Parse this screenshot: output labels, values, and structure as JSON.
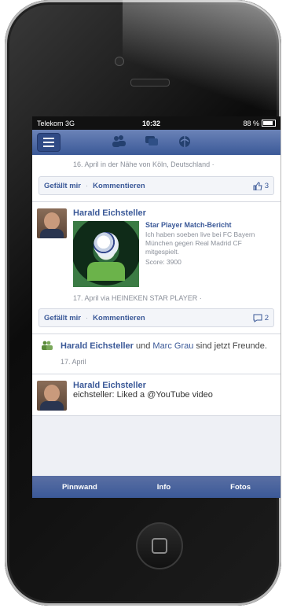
{
  "statusbar": {
    "carrier": "Telekom 3G",
    "time": "10:32",
    "battery": "88 %"
  },
  "navbar": {
    "icons": [
      "friends-icon",
      "messages-icon",
      "notifications-icon"
    ]
  },
  "feed": {
    "post1": {
      "meta": "16. April in der Nähe von Köln, Deutschland ·",
      "like": "Gefällt mir",
      "comment": "Kommentieren",
      "likes_count": "3"
    },
    "post2": {
      "author": "Harald Eichsteller",
      "att_title": "Star Player Match-Bericht",
      "att_desc": "Ich haben soeben live bei FC Bayern München gegen Real Madrid CF mitgespielt.",
      "att_score": "Score: 3900",
      "meta": "17. April via HEINEKEN STAR PLAYER ·",
      "like": "Gefällt mir",
      "comment": "Kommentieren",
      "comments_count": "2"
    },
    "friendship": {
      "name1": "Harald Eichsteller",
      "connector": " und ",
      "name2": "Marc Grau",
      "suffix": " sind jetzt Freunde.",
      "date": "17. April"
    },
    "post3": {
      "author": "Harald Eichsteller",
      "text": "eichsteller: Liked a @YouTube video"
    }
  },
  "bottombar": {
    "tabs": [
      "Pinnwand",
      "Info",
      "Fotos"
    ]
  },
  "colors": {
    "facebook_blue": "#3b5998"
  }
}
